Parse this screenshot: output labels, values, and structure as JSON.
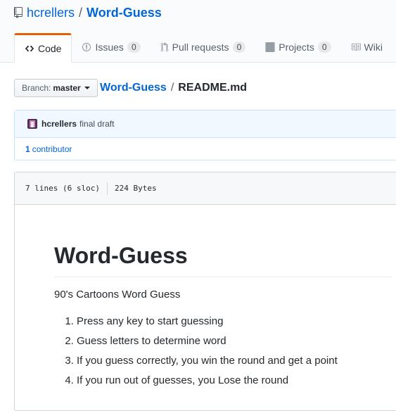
{
  "repo": {
    "owner": "hcrellers",
    "separator": "/",
    "name": "Word-Guess"
  },
  "tabs": [
    {
      "label": "Code",
      "icon": "code-icon",
      "selected": true
    },
    {
      "label": "Issues",
      "icon": "issue-opened-icon",
      "count": "0"
    },
    {
      "label": "Pull requests",
      "icon": "git-pull-request-icon",
      "count": "0"
    },
    {
      "label": "Projects",
      "icon": "project-icon",
      "count": "0"
    },
    {
      "label": "Wiki",
      "icon": "book-icon"
    }
  ],
  "branch": {
    "label": "Branch:",
    "value": "master"
  },
  "breadcrumb": {
    "repo": "Word-Guess",
    "separator": "/",
    "file": "README.md"
  },
  "commit": {
    "author": "hcrellers",
    "message": "final draft"
  },
  "contributors": {
    "count": "1",
    "label": "contributor"
  },
  "file_info": {
    "lines": "7 lines (6 sloc)",
    "size": "224 Bytes"
  },
  "readme": {
    "title": "Word-Guess",
    "subtitle": "90's Cartoons Word Guess",
    "steps": [
      "Press any key to start guessing",
      "Guess letters to determine word",
      "If you guess correctly, you win the round and get a point",
      "If you run out of guesses, you Lose the round"
    ]
  },
  "colors": {
    "link": "#0366d6",
    "tab_accent": "#e36209",
    "commit_bg": "#f1f8ff"
  }
}
